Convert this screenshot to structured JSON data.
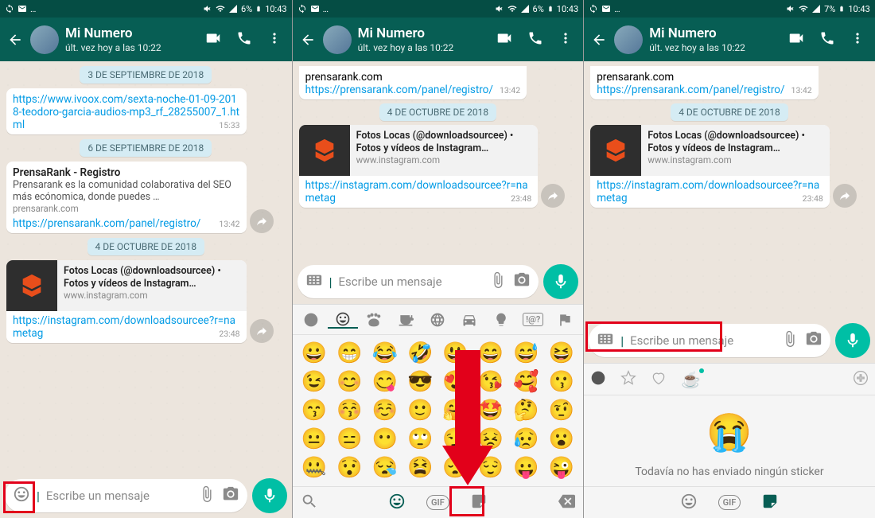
{
  "status": {
    "battery1": "6%",
    "battery2": "6%",
    "battery3": "7%",
    "time": "10:43"
  },
  "contact": {
    "name": "Mi Numero",
    "lastseen": "últ. vez hoy a las 10:22"
  },
  "dates": {
    "d1": "3 DE SEPTIEMBRE DE 2018",
    "d2": "6 DE SEPTIEMBRE DE 2018",
    "d3": "4 DE OCTUBRE DE 2018"
  },
  "msg_ivoox": {
    "link": "https://www.ivoox.com/sexta-noche-01-09-2018-teodoro-garcia-audios-mp3_rf_28255007_1.html",
    "time": "15:33"
  },
  "msg_prensa": {
    "title": "PrensaRank - Registro",
    "desc": "Prensarank es la comunidad colaborativa del SEO más ecónomica, donde puedes …",
    "domain": "prensarank.com",
    "link": "https://prensarank.com/panel/registro/",
    "time": "13:42"
  },
  "msg_ig": {
    "title": "Fotos Locas (@downloadsourcee) • Fotos y vídeos de Instagram…",
    "domain": "www.instagram.com",
    "link": "https://instagram.com/downloadsourcee?r=nametag",
    "time": "23:48"
  },
  "input": {
    "placeholder": "Escribe un mensaje"
  },
  "sticker": {
    "empty": "Todavía no has enviado ningún sticker"
  },
  "emoji_rows": [
    [
      "😀",
      "😁",
      "😂",
      "🤣",
      "😃",
      "😄",
      "😅",
      "😆"
    ],
    [
      "😉",
      "😊",
      "😋",
      "😎",
      "😍",
      "😘",
      "🥰",
      "😗"
    ],
    [
      "😙",
      "😚",
      "☺️",
      "🙂",
      "🤗",
      "🤩",
      "🤔",
      "🤨"
    ],
    [
      "😐",
      "😑",
      "😶",
      "🙄",
      "😏",
      "😣",
      "😥",
      "😮"
    ],
    [
      "🤐",
      "😯",
      "😪",
      "😫",
      "😴",
      "😌",
      "😛",
      "😜"
    ]
  ],
  "gif_label": "GIF"
}
